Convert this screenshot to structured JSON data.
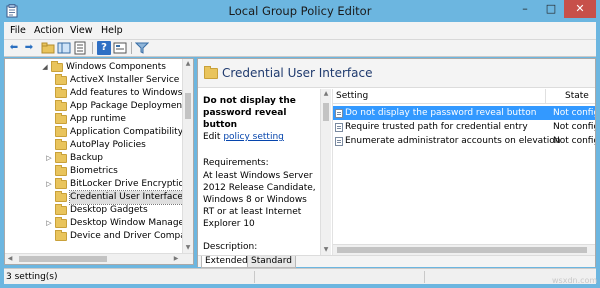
{
  "window": {
    "title": "Local Group Policy Editor",
    "accent": "#6cb6e0"
  },
  "caption_buttons": {
    "minimize": "–",
    "maximize": "□",
    "close": "✕"
  },
  "menu": [
    "File",
    "Action",
    "View",
    "Help"
  ],
  "toolbar": [
    "back-icon",
    "forward-icon",
    "up-folder-icon",
    "show-hide-tree-icon",
    "export-list-icon",
    "help-icon",
    "properties-icon",
    "filter-icon"
  ],
  "tree": {
    "items": [
      {
        "label": "Windows Components",
        "expander": "◢",
        "selected": false
      },
      {
        "label": "ActiveX Installer Service",
        "expander": "",
        "selected": false
      },
      {
        "label": "Add features to Windows 8",
        "expander": "",
        "selected": false
      },
      {
        "label": "App Package Deployment",
        "expander": "",
        "selected": false
      },
      {
        "label": "App runtime",
        "expander": "",
        "selected": false
      },
      {
        "label": "Application Compatibility",
        "expander": "",
        "selected": false
      },
      {
        "label": "AutoPlay Policies",
        "expander": "",
        "selected": false
      },
      {
        "label": "Backup",
        "expander": "▷",
        "selected": false
      },
      {
        "label": "Biometrics",
        "expander": "",
        "selected": false
      },
      {
        "label": "BitLocker Drive Encryption",
        "expander": "▷",
        "selected": false
      },
      {
        "label": "Credential User Interface",
        "expander": "",
        "selected": true
      },
      {
        "label": "Desktop Gadgets",
        "expander": "",
        "selected": false
      },
      {
        "label": "Desktop Window Manager",
        "expander": "▷",
        "selected": false
      },
      {
        "label": "Device and Driver Compatibi",
        "expander": "",
        "selected": false
      }
    ]
  },
  "header": {
    "title": "Credential User Interface"
  },
  "description": {
    "title": "Do not display the password reveal button",
    "edit_prefix": "Edit",
    "edit_link": "policy setting",
    "requirements_label": "Requirements:",
    "requirements_text": "At least Windows Server 2012 Release Candidate, Windows 8 or Windows RT or at least Internet Explorer 10",
    "description_label": "Description:"
  },
  "list": {
    "columns": {
      "setting": "Setting",
      "state": "State"
    },
    "rows": [
      {
        "setting": "Do not display the password reveal button",
        "state": "Not config",
        "selected": true
      },
      {
        "setting": "Require trusted path for credential entry",
        "state": "Not config",
        "selected": false
      },
      {
        "setting": "Enumerate administrator accounts on elevation",
        "state": "Not config",
        "selected": false
      }
    ]
  },
  "tabs": [
    "Extended",
    "Standard"
  ],
  "status": {
    "text": "3 setting(s)"
  },
  "watermark": "wsxdn.com"
}
